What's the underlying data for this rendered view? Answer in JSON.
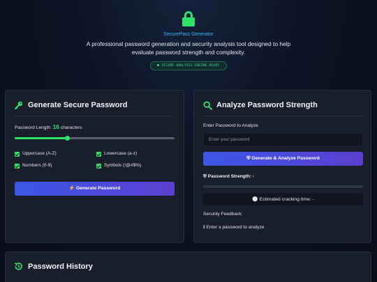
{
  "header": {
    "app_name": "SecurePass Generator",
    "description": "A professional password generation and security analysis tool designed to help evaluate password strength and complexity.",
    "status_text": "SECURE ANALYSIS ENGINE READY",
    "lock_icon": "lock-icon",
    "accent_color": "#2ee26a"
  },
  "generate": {
    "title": "Generate Secure Password",
    "icon": "key-icon",
    "length_label": "Password Length:",
    "length_value": "16",
    "length_unit": "characters",
    "length_fraction": 0.33,
    "options": [
      {
        "label": "Uppercase (A-Z)",
        "checked": true
      },
      {
        "label": "Lowercase (a-z)",
        "checked": true
      },
      {
        "label": "Numbers (0-9)",
        "checked": true
      },
      {
        "label": "Symbols (!@#$%)",
        "checked": true
      }
    ],
    "button_label": "Generate Password",
    "button_icon": "bolt-icon"
  },
  "analyze": {
    "title": "Analyze Password Strength",
    "icon": "search-icon",
    "input_label": "Enter Password to Analyze",
    "input_placeholder": "Enter your password",
    "button_label": "Generate & Analyze Password",
    "button_icon": "shield-icon",
    "strength_label": "Password Strength: -",
    "crack_time": "Estimated cracking time: -",
    "feedback_label": "Security Feedback:",
    "feedback_text": "Enter a password to analyze"
  },
  "history": {
    "title": "Password History",
    "icon": "history-icon"
  }
}
